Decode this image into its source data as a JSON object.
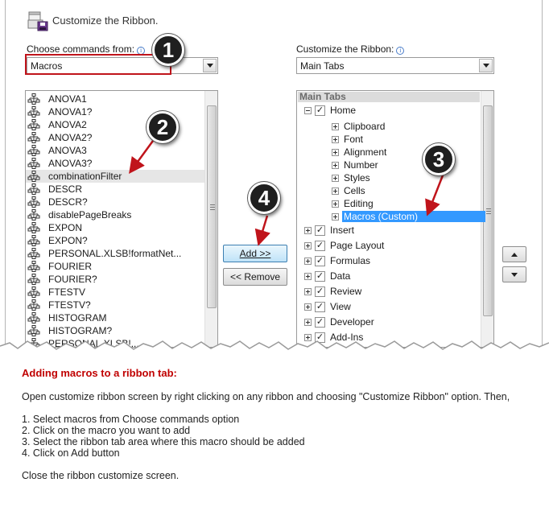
{
  "dialog": {
    "header_title": "Customize the Ribbon.",
    "left": {
      "label": "Choose commands from:",
      "combo_value": "Macros",
      "items": [
        "ANOVA1",
        "ANOVA1?",
        "ANOVA2",
        "ANOVA2?",
        "ANOVA3",
        "ANOVA3?",
        "combinationFilter",
        "DESCR",
        "DESCR?",
        "disablePageBreaks",
        "EXPON",
        "EXPON?",
        "PERSONAL.XLSB!formatNet...",
        "FOURIER",
        "FOURIER?",
        "FTESTV",
        "FTESTV?",
        "HISTOGRAM",
        "HISTOGRAM?",
        "PERSONAL.XLSB!..."
      ],
      "selected_index": 6
    },
    "right": {
      "label": "Customize the Ribbon:",
      "combo_value": "Main Tabs",
      "tree_header": "Main Tabs",
      "home_label": "Home",
      "home_groups": [
        "Clipboard",
        "Font",
        "Alignment",
        "Number",
        "Styles",
        "Cells",
        "Editing",
        "Macros (Custom)"
      ],
      "selected_group_index": 7,
      "tabs": [
        "Insert",
        "Page Layout",
        "Formulas",
        "Data",
        "Review",
        "View",
        "Developer",
        "Add-Ins"
      ]
    },
    "buttons": {
      "add": "Add >>",
      "remove": "<< Remove"
    },
    "steps": [
      "1",
      "2",
      "3",
      "4"
    ]
  },
  "caption": {
    "title": "Adding macros to a ribbon tab:",
    "intro": "Open customize ribbon screen by right clicking on any ribbon and choosing \"Customize Ribbon\" option. Then,",
    "steps": [
      "1. Select macros from Choose commands option",
      "2. Click on the macro you want to add",
      "3. Select the ribbon tab area where this macro should be added",
      "4. Click on Add button"
    ],
    "outro": "Close the ribbon customize screen."
  },
  "colors": {
    "accent_red": "#c0141b",
    "selection_blue": "#3399ff",
    "caption_title": "#c00000"
  }
}
